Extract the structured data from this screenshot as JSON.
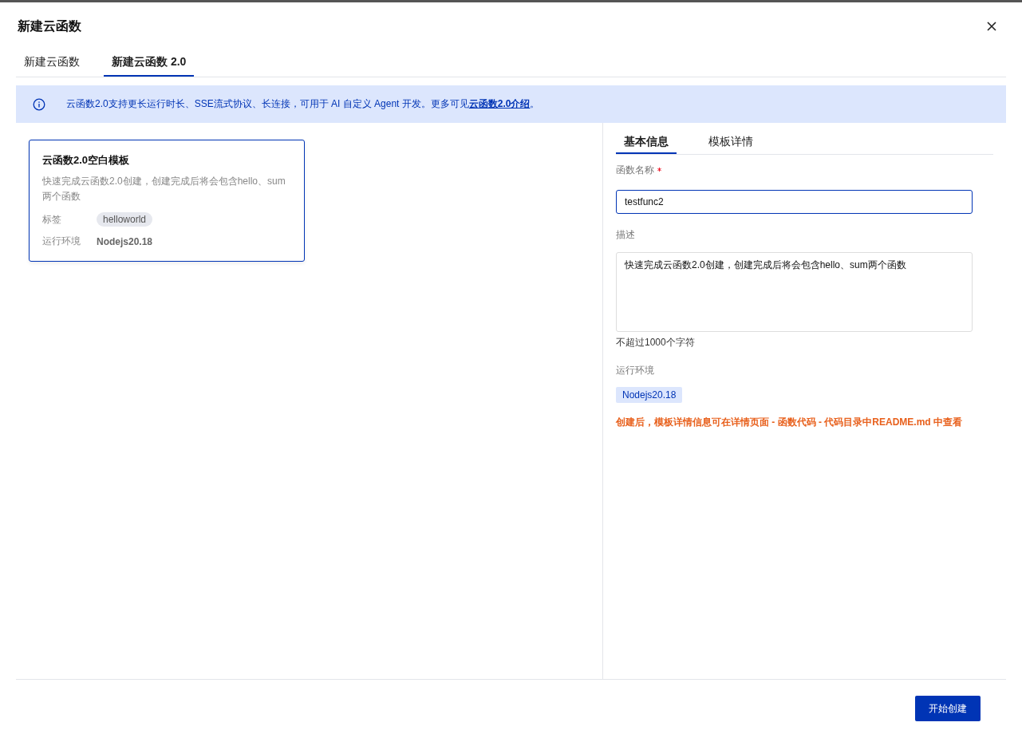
{
  "dialog": {
    "title": "新建云函数"
  },
  "tabs": [
    {
      "label": "新建云函数",
      "selected": false
    },
    {
      "label": "新建云函数 2.0",
      "selected": true
    }
  ],
  "notice": {
    "text": "云函数2.0支持更长运行时长、SSE流式协议、长连接，可用于 AI 自定义 Agent 开发。更多可见",
    "link": "云函数2.0介绍",
    "suffix": "。"
  },
  "templates": [
    {
      "title": "云函数2.0空白模板",
      "description": "快速完成云函数2.0创建，创建完成后将会包含hello、sum两个函数",
      "tag_label": "标签",
      "tags": [
        "helloworld"
      ],
      "runtime_label": "运行环境",
      "runtime": "Nodejs20.18",
      "selected": true
    }
  ],
  "detail_tabs": [
    {
      "label": "基本信息",
      "selected": true
    },
    {
      "label": "模板详情",
      "selected": false
    }
  ],
  "form": {
    "name_label": "函数名称",
    "name_required": true,
    "name_value": "testfunc2",
    "description_label": "描述",
    "description_value": "快速完成云函数2.0创建，创建完成后将会包含hello、sum两个函数",
    "description_hint": "不超过1000个字符",
    "runtime_label": "运行环境",
    "runtime_value": "Nodejs20.18",
    "warning": "创建后，模板详情信息可在详情页面 - 函数代码 - 代码目录中README.md 中查看"
  },
  "footer": {
    "primary_button": "开始创建"
  }
}
